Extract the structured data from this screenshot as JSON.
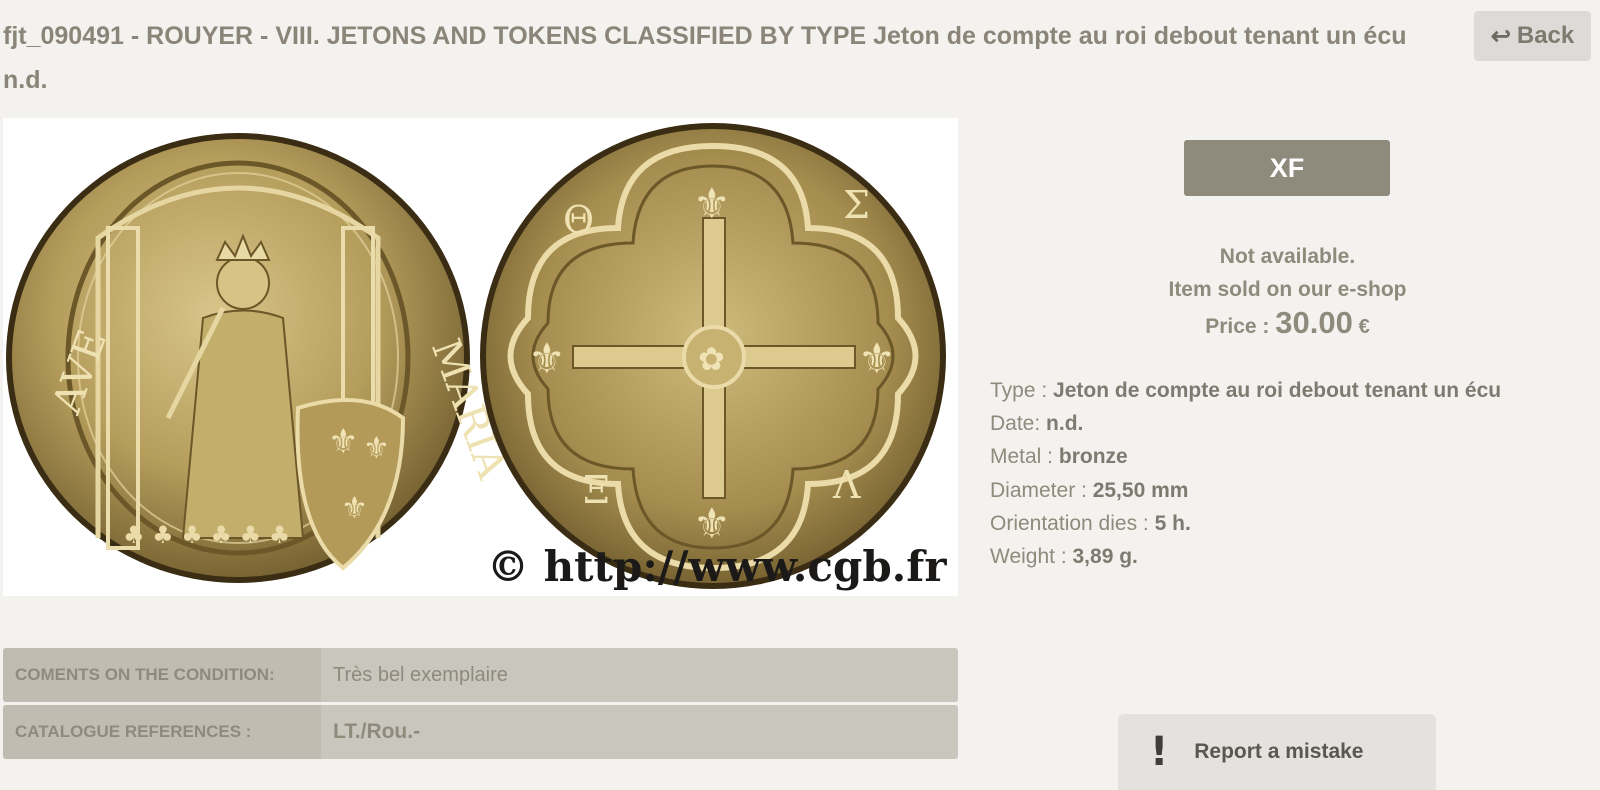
{
  "header": {
    "title": "fjt_090491 - ROUYER - VIII. JETONS AND TOKENS CLASSIFIED BY TYPE Jeton de compte au roi debout tenant un écu n.d.",
    "back_label": "Back",
    "back_icon": "return-arrow-icon"
  },
  "photo": {
    "watermark": "© http://www.cgb.fr"
  },
  "grade": "XF",
  "availability": {
    "line1": "Not available.",
    "line2": "Item sold on our e-shop",
    "price_label": "Price :",
    "price_value": "30.00",
    "currency": "€"
  },
  "specs": [
    {
      "label": "Type :",
      "value": "Jeton de compte au roi debout tenant un écu"
    },
    {
      "label": "Date:",
      "value": "n.d."
    },
    {
      "label": "Metal :",
      "value": "bronze"
    },
    {
      "label": "Diameter :",
      "value": "25,50 mm"
    },
    {
      "label": "Orientation dies :",
      "value": "5 h."
    },
    {
      "label": "Weight :",
      "value": "3,89 g."
    }
  ],
  "condition_table": [
    {
      "label": "COMENTS ON THE CONDITION:",
      "value": "Très bel exemplaire"
    },
    {
      "label": "CATALOGUE REFERENCES :",
      "value": "LT./Rou.-"
    }
  ],
  "report": {
    "label": "Report a mistake",
    "icon": "exclamation-icon"
  },
  "colors": {
    "background": "#f3f2ef",
    "badge": "#8e8a7c",
    "text": "#8a8578",
    "coin_bronze": "#b59d5c"
  }
}
